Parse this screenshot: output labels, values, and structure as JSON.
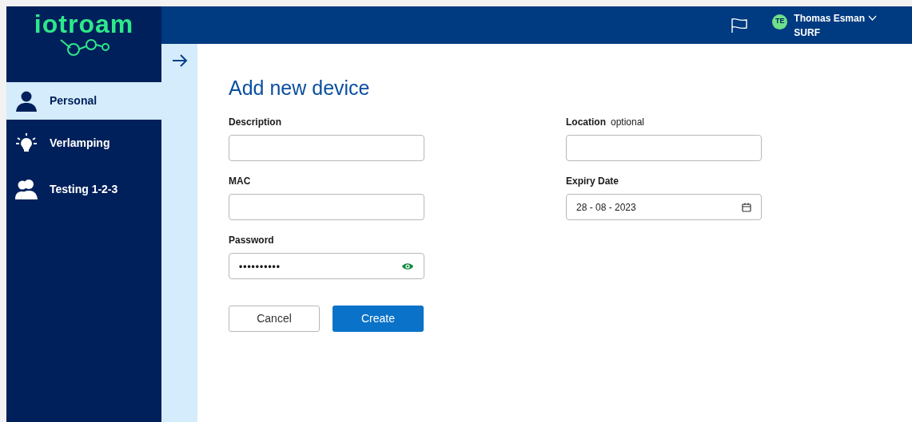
{
  "logo": {
    "text": "iotroam"
  },
  "sidebar": {
    "items": [
      {
        "label": "Personal",
        "selected": true
      },
      {
        "label": "Verlamping",
        "selected": false
      },
      {
        "label": "Testing 1-2-3",
        "selected": false
      }
    ]
  },
  "header": {
    "user": {
      "initials": "TE",
      "name": "Thomas Esman",
      "organization": "SURF"
    }
  },
  "form": {
    "title": "Add new device",
    "fields": [
      {
        "label": "Description",
        "kind": "text"
      },
      {
        "label": "Location",
        "hint": "optional",
        "kind": "text"
      },
      {
        "label": "MAC",
        "kind": "text"
      },
      {
        "label": "Expiry Date",
        "kind": "date",
        "value": "28 - 08 - 2023"
      },
      {
        "label": "Password",
        "kind": "password",
        "value": "••••••••••"
      }
    ],
    "buttons": [
      {
        "label": "Cancel",
        "kind": "secondary"
      },
      {
        "label": "Create",
        "kind": "primary"
      }
    ]
  }
}
